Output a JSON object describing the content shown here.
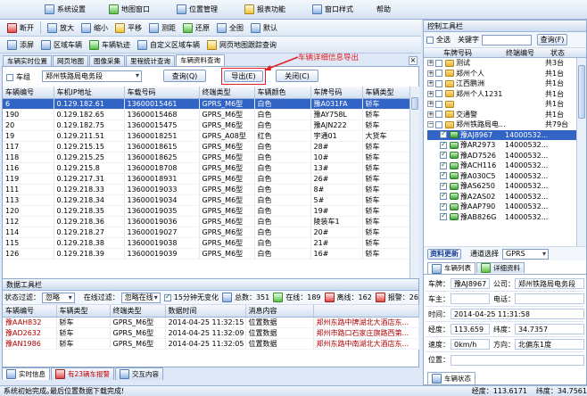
{
  "menu": [
    {
      "label": "系统设置",
      "icon": "settings-icon"
    },
    {
      "label": "地图窗口",
      "icon": "map-icon"
    },
    {
      "label": "位置管理",
      "icon": "location-icon"
    },
    {
      "label": "报表功能",
      "icon": "report-icon"
    },
    {
      "label": "窗口样式",
      "icon": "window-icon"
    },
    {
      "label": "帮助",
      "icon": "help-icon"
    }
  ],
  "toolbar1": [
    "断开",
    "放大",
    "缩小",
    "平移",
    "测距",
    "还原",
    "全图",
    "默认"
  ],
  "toolbar2": [
    "添屏",
    "区域车辆",
    "车辆轨迹",
    "自定义区域车辆",
    "网页地图跟踪查询"
  ],
  "main_tabs": [
    "车辆实时位置",
    "网页地图",
    "图像采集",
    "里程统计查询",
    "车辆资料查询"
  ],
  "filter": {
    "checkbox_label": "车组",
    "select_value": "郑州铁路局电务段",
    "query_btn": "查询(Q)",
    "export_btn": "导出(E)",
    "close_btn": "关闭(C)"
  },
  "annotation": "车辆详细信息导出",
  "vehicle_table": {
    "columns": [
      "车辆编号",
      "车机IP地址",
      "车载号码",
      "终端类型",
      "车辆颜色",
      "车牌号码",
      "车辆类型"
    ],
    "rows": [
      [
        "6",
        "0.129.182.61",
        "13600015461",
        "GPRS_M6型",
        "白色",
        "豫A031FA",
        "轿车"
      ],
      [
        "190",
        "0.129.182.65",
        "13600015468",
        "GPRS_M6型",
        "白色",
        "豫AY758L",
        "轿车"
      ],
      [
        "20",
        "0.129.182.75",
        "13600015475",
        "GPRS_M6型",
        "白色",
        "豫AJN222",
        "轿车"
      ],
      [
        "19",
        "0.129.211.51",
        "13600018251",
        "GPRS_A08型",
        "红色",
        "宇通01",
        "大货车"
      ],
      [
        "117",
        "0.129.215.15",
        "13600018615",
        "GPRS_M6型",
        "白色",
        "28#",
        "轿车"
      ],
      [
        "118",
        "0.129.215.25",
        "13600018625",
        "GPRS_M6型",
        "白色",
        "10#",
        "轿车"
      ],
      [
        "116",
        "0.129.215.8",
        "13600018708",
        "GPRS_M6型",
        "白色",
        "13#",
        "轿车"
      ],
      [
        "119",
        "0.129.217.31",
        "13600018931",
        "GPRS_M6型",
        "白色",
        "26#",
        "轿车"
      ],
      [
        "111",
        "0.129.218.33",
        "13600019033",
        "GPRS_M6型",
        "白色",
        "8#",
        "轿车"
      ],
      [
        "113",
        "0.129.218.34",
        "13600019034",
        "GPRS_M6型",
        "白色",
        "5#",
        "轿车"
      ],
      [
        "120",
        "0.129.218.35",
        "13600019035",
        "GPRS_M6型",
        "白色",
        "19#",
        "轿车"
      ],
      [
        "112",
        "0.129.218.36",
        "13600019036",
        "GPRS_M6型",
        "白色",
        "陵装车1",
        "轿车"
      ],
      [
        "114",
        "0.129.218.27",
        "13600019027",
        "GPRS_M6型",
        "白色",
        "20#",
        "轿车"
      ],
      [
        "115",
        "0.129.218.38",
        "13600019038",
        "GPRS_M6型",
        "白色",
        "21#",
        "轿车"
      ],
      [
        "126",
        "0.129.218.39",
        "13600019039",
        "GPRS_M6型",
        "白色",
        "16#",
        "轿车"
      ]
    ]
  },
  "data_toolbar": {
    "title": "数据工具栏",
    "status_filter_label": "状态过滤：",
    "status_filter_value": "忽略",
    "online_filter_label": "在线过滤：",
    "online_filter_value": "忽略在线",
    "refresh_label": "15分钟无变化",
    "total": "总数：351",
    "online": "在线：189",
    "offline": "离线：162",
    "alarm": "报警：26"
  },
  "msg_table": {
    "columns": [
      "车辆编号",
      "车辆类型",
      "终端类型",
      "数据时间",
      "消息内容",
      ""
    ],
    "rows": [
      [
        "豫AAH832",
        "轿车",
        "GPRS_M6型",
        "2014-04-25 11:32:15",
        "位置数据",
        "郑州东路中牌湖北大酒店东..."
      ],
      [
        "豫AD2632",
        "轿车",
        "GPRS_M6型",
        "2014-04-25 11:32:09",
        "位置数据",
        "郑州市路口石家庄旗路西第..."
      ],
      [
        "豫AN1986",
        "轿车",
        "GPRS_M6型",
        "2014-04-25 11:32:05",
        "位置数据",
        "郑州东路中南湖北大酒店东..."
      ]
    ]
  },
  "bottom_tabs": [
    "实时信息",
    "有23辆车报警",
    "交互内容"
  ],
  "status_left": "系统初始完成。",
  "status_mid": "最后位置数据下载完成!",
  "status_lon": "经度：113.6171",
  "status_lat": "纬度：34.7561",
  "right_panel": {
    "title": "控制工具栏",
    "all_select": "全选",
    "keyword_label": "关键字",
    "query_btn": "查询(F)",
    "tree_cols": [
      "车牌号码",
      "终端编号",
      "状态"
    ],
    "groups": [
      {
        "name": "测试",
        "count": "共3台"
      },
      {
        "name": "郑州个人",
        "count": "共1台"
      },
      {
        "name": "江西鹏洲",
        "count": "共1台"
      },
      {
        "name": "郑州个人1231",
        "count": "共1台"
      },
      {
        "name": "",
        "count": "共1台"
      },
      {
        "name": "交通警",
        "count": "共1台"
      },
      {
        "name": "郑州铁路局电...",
        "count": "共79台"
      }
    ],
    "vehicles": [
      [
        "豫AJ8967",
        "14000532..."
      ],
      [
        "豫AR2973",
        "14000532..."
      ],
      [
        "豫AD7526",
        "14000532..."
      ],
      [
        "豫ACH116",
        "14000532..."
      ],
      [
        "豫A030C5",
        "14000532..."
      ],
      [
        "豫AS6250",
        "14000532..."
      ],
      [
        "豫A2AS02",
        "14000532..."
      ],
      [
        "豫AAP790",
        "14000532..."
      ],
      [
        "豫AB826G",
        "14000532..."
      ]
    ],
    "update_btn": "资料更新",
    "channel_label": "通道选择",
    "channel_value": "GPRS",
    "tabs": [
      "车辆列表",
      "详细资料"
    ],
    "detail": {
      "plate_label": "车牌：",
      "plate": "豫AJ8967",
      "company_label": "公司：",
      "company": "郑州铁路局电务段",
      "owner_label": "车主：",
      "owner": "",
      "phone_label": "电话：",
      "phone": "",
      "time_label": "时间：",
      "time": "2014-04-25 11:31:58",
      "lon_label": "经度：",
      "lon": "113.659",
      "lat_label": "纬度：",
      "lat": "34.7357",
      "speed_label": "速度：",
      "speed": "0km/h",
      "dir_label": "方向：",
      "dir": "北偏东1度",
      "addr_label": "位置：",
      "addr": ""
    },
    "bottom_tab": "车辆状态"
  }
}
